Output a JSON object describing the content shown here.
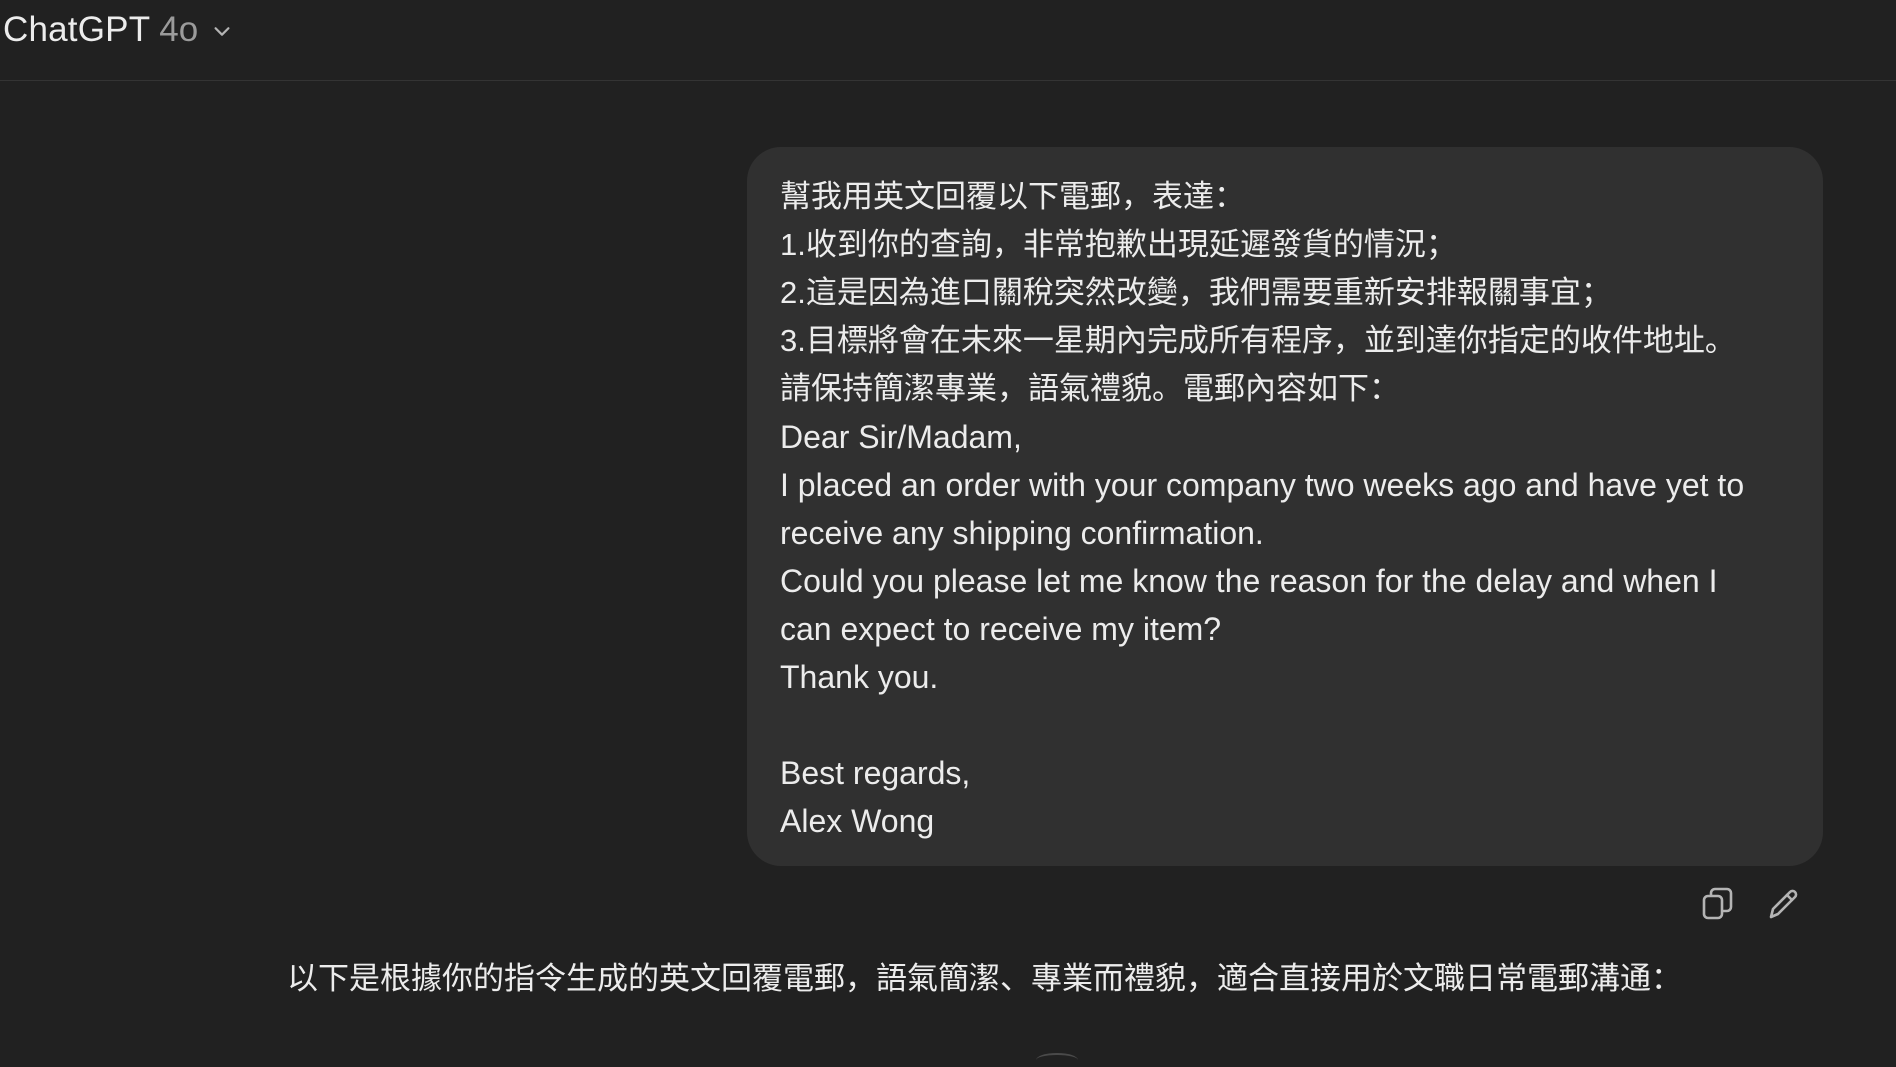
{
  "header": {
    "model_name": "ChatGPT",
    "model_version": "4o",
    "chevron_icon": "chevron-down-icon"
  },
  "user_message": {
    "lines": [
      "幫我用英文回覆以下電郵，表達：",
      "1.收到你的查詢，非常抱歉出現延遲發貨的情況；",
      "2.這是因為進口關稅突然改變，我們需要重新安排報關事宜；",
      "3.目標將會在未來一星期內完成所有程序，並到達你指定的收件地址。",
      "請保持簡潔專業，語氣禮貌。電郵內容如下：",
      "Dear Sir/Madam,",
      "I placed an order with your company two weeks ago and have yet to",
      "receive any shipping confirmation.",
      "Could you please let me know the reason for the delay and when I",
      "can expect to receive my item?",
      "Thank you.",
      "",
      "Best regards,",
      "Alex Wong"
    ]
  },
  "message_actions": {
    "copy_icon": "copy-icon",
    "edit_icon": "edit-pencil-icon"
  },
  "assistant_message": {
    "intro": "以下是根據你的指令生成的英文回覆電郵，語氣簡潔、專業而禮貌，適合直接用於文職日常電郵溝通："
  }
}
